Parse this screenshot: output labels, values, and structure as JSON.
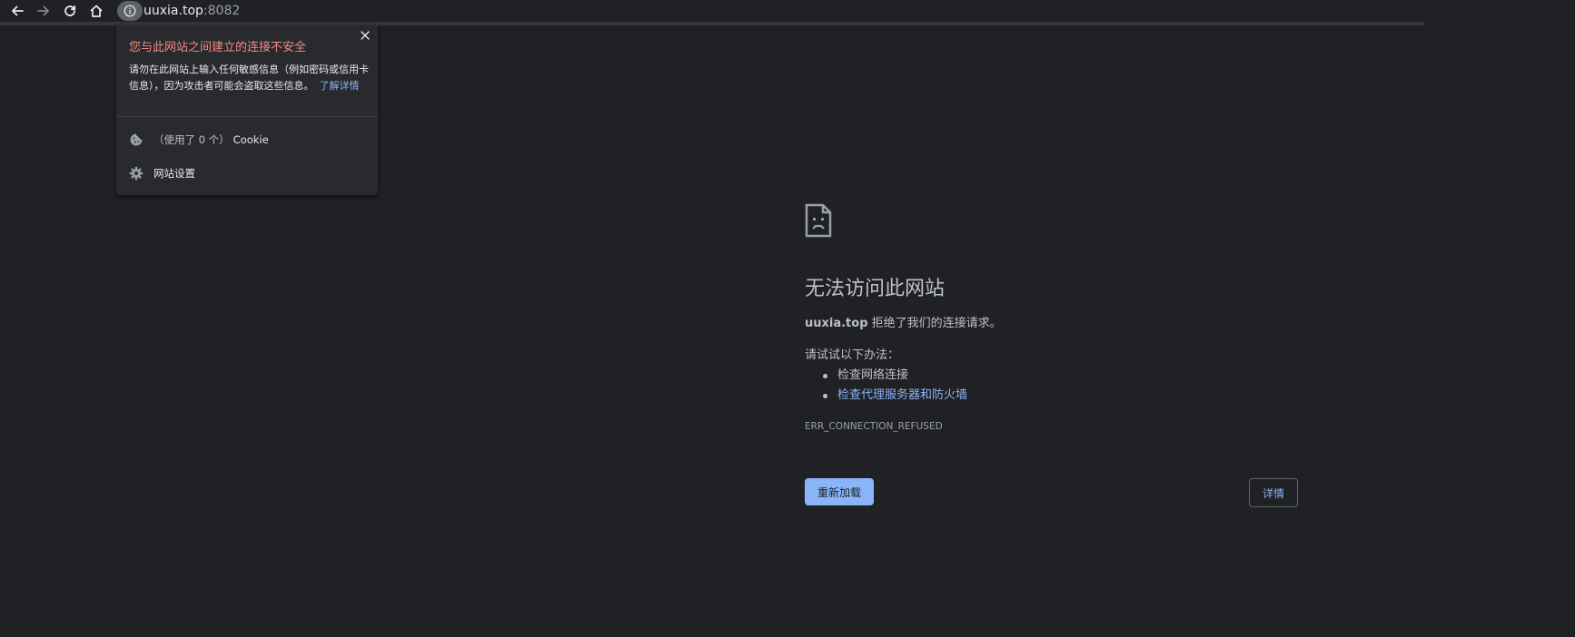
{
  "toolbar": {
    "back_icon": "arrow-left-icon",
    "forward_icon": "arrow-right-icon",
    "reload_icon": "reload-icon",
    "home_icon": "home-icon",
    "site_info_icon": "info-icon",
    "url_host": "uuxia.top",
    "url_port": ":8082"
  },
  "site_info_popup": {
    "title": "您与此网站之间建立的连接不安全",
    "description": "请勿在此网站上输入任何敏感信息（例如密码或信用卡信息），因为攻击者可能会盗取这些信息。",
    "learn_more": "了解详情",
    "close_icon": "close-icon",
    "cookie_row": {
      "icon": "cookie-icon",
      "count_text": "（使用了 0 个）",
      "label": "Cookie"
    },
    "settings_row": {
      "icon": "gear-icon",
      "label": "网站设置"
    }
  },
  "error_page": {
    "icon": "sad-page-icon",
    "title": "无法访问此网站",
    "host": "uuxia.top",
    "summary_suffix": " 拒绝了我们的连接请求。",
    "suggestions_heading": "请试试以下办法：",
    "suggestions": [
      {
        "text": "检查网络连接",
        "is_link": false
      },
      {
        "text": "检查代理服务器和防火墙",
        "is_link": true
      }
    ],
    "error_code": "ERR_CONNECTION_REFUSED",
    "reload_label": "重新加载",
    "details_label": "详情"
  },
  "colors": {
    "background": "#202124",
    "popup_background": "#292a2d",
    "warning_red": "#f28b82",
    "link_blue": "#8ab4f8",
    "text_secondary": "#bdc1c6"
  }
}
